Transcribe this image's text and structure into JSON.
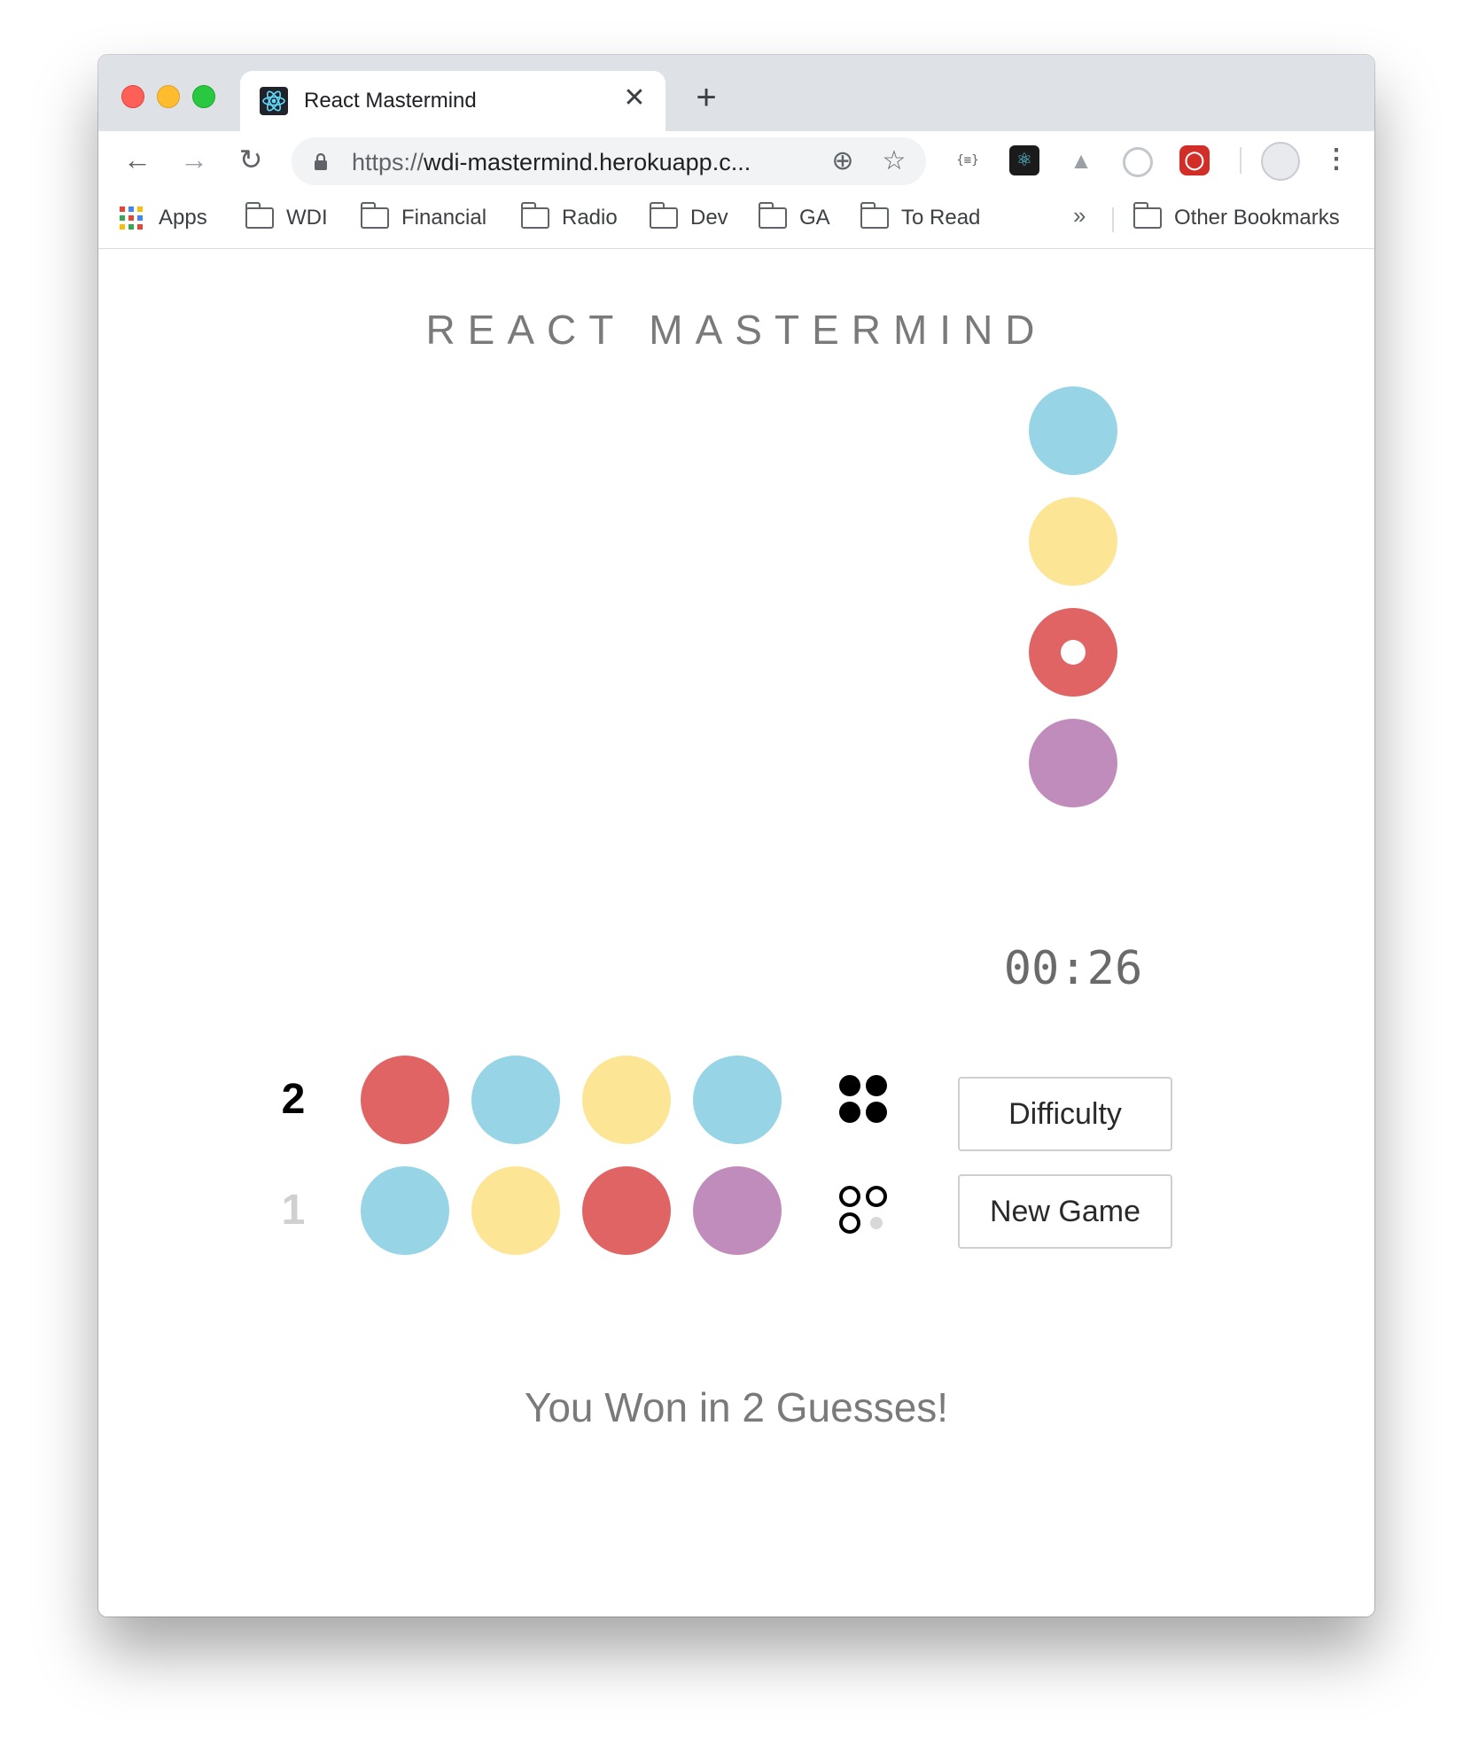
{
  "browser": {
    "tab_title": "React Mastermind",
    "tab_close": "✕",
    "new_tab": "+",
    "nav": {
      "back": "←",
      "forward": "→",
      "reload": "↻"
    },
    "url_scheme": "https://",
    "url_rest": "wdi-mastermind.herokuapp.c...",
    "zoom_icon": "⊕",
    "star_icon": "☆",
    "ext_json": "{≡}",
    "ext_react": "⚛",
    "ext_drive": "▲",
    "ext_lastpass": "◯",
    "menu": "⋮",
    "bookmarks": [
      "Apps",
      "WDI",
      "Financial",
      "Radio",
      "Dev",
      "GA",
      "To Read"
    ],
    "bookmarks_more": "»",
    "other_bookmarks": "Other Bookmarks"
  },
  "colors": {
    "red": "#e06464",
    "blue": "#96d4e6",
    "yellow": "#fce696",
    "purple": "#c08cbc"
  },
  "game": {
    "title": "REACT  MASTERMIND",
    "palette": [
      "blue",
      "yellow",
      "red",
      "purple"
    ],
    "selected_color": "red",
    "timer": "00:26",
    "guesses": [
      {
        "number": "2",
        "pegs": [
          "red",
          "blue",
          "yellow",
          "blue"
        ],
        "score": {
          "perfect": 4,
          "almost": 0,
          "none": 0
        },
        "current": true
      },
      {
        "number": "1",
        "pegs": [
          "blue",
          "yellow",
          "red",
          "purple"
        ],
        "score": {
          "perfect": 0,
          "almost": 3,
          "none": 1
        },
        "current": false
      }
    ],
    "buttons": {
      "difficulty": "Difficulty",
      "new_game": "New Game"
    },
    "message": "You Won in 2 Guesses!"
  }
}
